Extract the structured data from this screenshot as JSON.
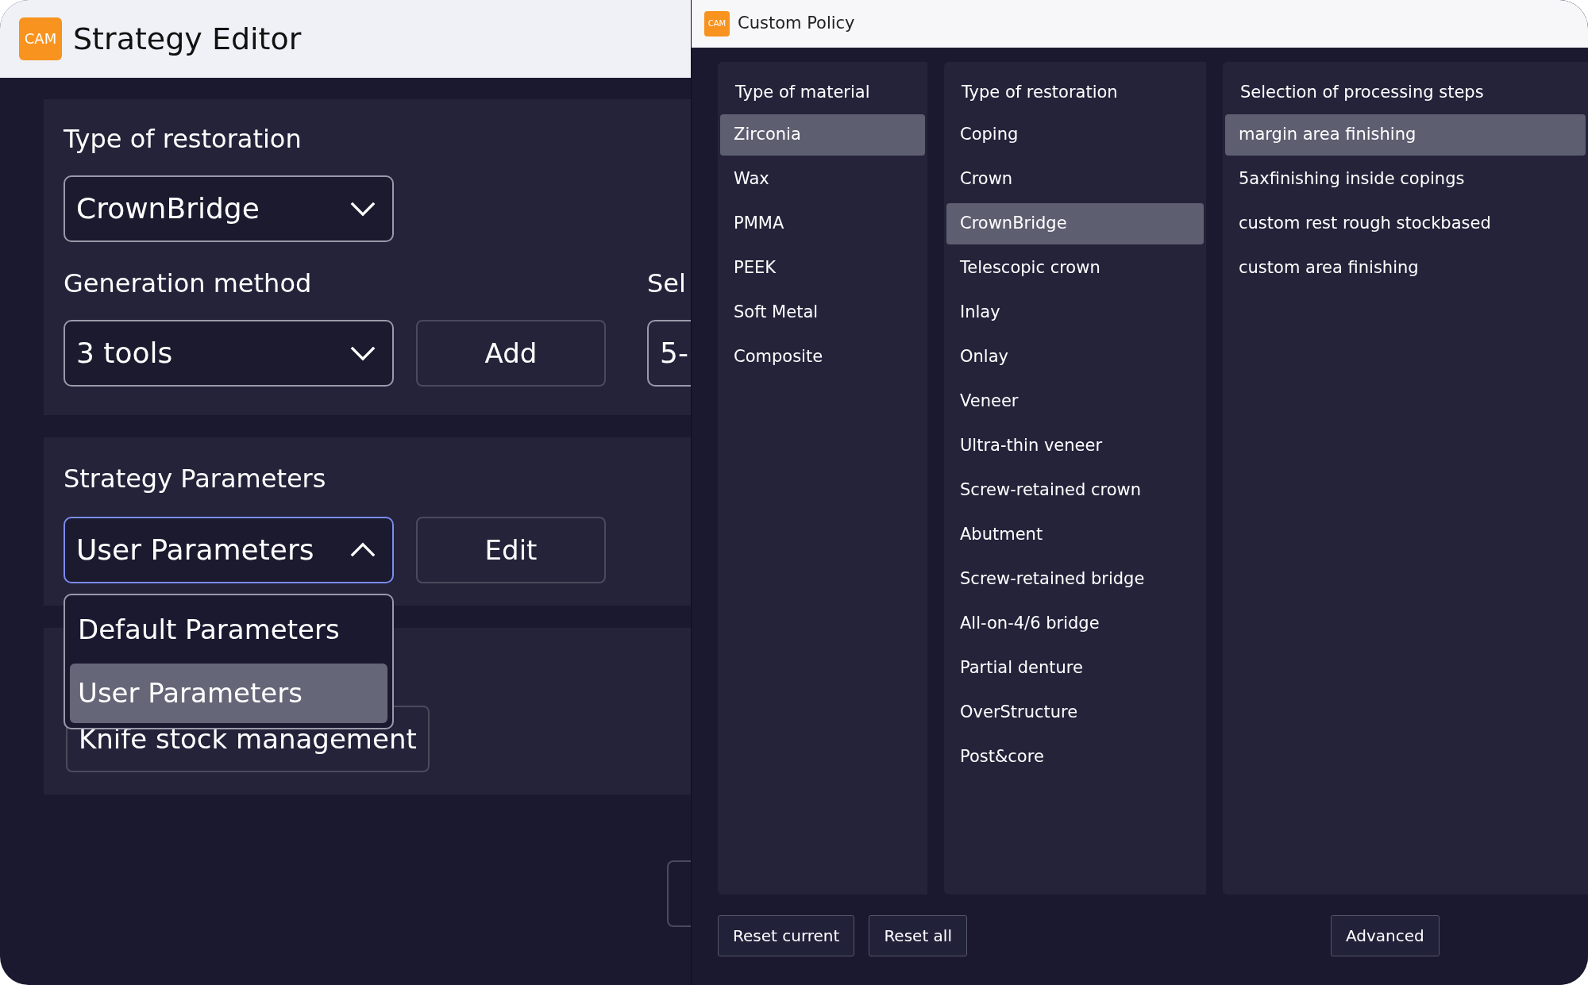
{
  "strategy_editor": {
    "logo": "CAM",
    "title": "Strategy Editor",
    "restoration": {
      "label": "Type of restoration",
      "value": "CrownBridge",
      "expanded": false
    },
    "generation": {
      "label": "Generation method",
      "value": "3 tools",
      "expanded": false
    },
    "add_button": "Add",
    "selection": {
      "label": "Sel",
      "value": "5-"
    },
    "strategy": {
      "label": "Strategy Parameters",
      "value": "User Parameters",
      "expanded": true,
      "options": [
        {
          "label": "Default Parameters",
          "selected": false
        },
        {
          "label": "User Parameters",
          "selected": true
        }
      ]
    },
    "edit_button": "Edit",
    "knife_button": "Knife stock management"
  },
  "custom_policy": {
    "logo": "CAM",
    "title": "Custom Policy",
    "columns": [
      {
        "header": "Type of material",
        "items": [
          {
            "label": "Zirconia",
            "selected": true
          },
          {
            "label": "Wax",
            "selected": false
          },
          {
            "label": "PMMA",
            "selected": false
          },
          {
            "label": "PEEK",
            "selected": false
          },
          {
            "label": "Soft Metal",
            "selected": false
          },
          {
            "label": "Composite",
            "selected": false
          }
        ]
      },
      {
        "header": "Type of restoration",
        "items": [
          {
            "label": "Coping",
            "selected": false
          },
          {
            "label": "Crown",
            "selected": false
          },
          {
            "label": "CrownBridge",
            "selected": true
          },
          {
            "label": "Telescopic crown",
            "selected": false
          },
          {
            "label": "Inlay",
            "selected": false
          },
          {
            "label": "Onlay",
            "selected": false
          },
          {
            "label": "Veneer",
            "selected": false
          },
          {
            "label": "Ultra-thin veneer",
            "selected": false
          },
          {
            "label": "Screw-retained crown",
            "selected": false
          },
          {
            "label": "Abutment",
            "selected": false
          },
          {
            "label": "Screw-retained bridge",
            "selected": false
          },
          {
            "label": "All-on-4/6 bridge",
            "selected": false
          },
          {
            "label": "Partial denture",
            "selected": false
          },
          {
            "label": "OverStructure",
            "selected": false
          },
          {
            "label": "Post&core",
            "selected": false
          }
        ]
      },
      {
        "header": "Selection of processing steps",
        "items": [
          {
            "label": "margin area finishing",
            "selected": true
          },
          {
            "label": "5axfinishing inside copings",
            "selected": false
          },
          {
            "label": "custom rest rough stockbased",
            "selected": false
          },
          {
            "label": "custom area finishing",
            "selected": false
          }
        ]
      }
    ],
    "buttons": [
      "Reset current",
      "Reset all",
      "Advanced"
    ]
  }
}
